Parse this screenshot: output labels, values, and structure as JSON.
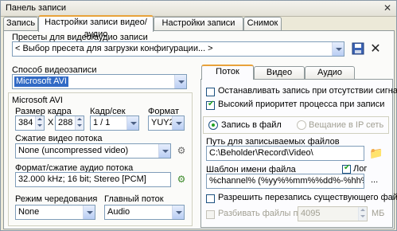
{
  "window": {
    "title": "Панель записи"
  },
  "tabs": [
    {
      "label": "Запись"
    },
    {
      "label": "Настройки записи видео/аудио"
    },
    {
      "label": "Настройки записи аудио"
    },
    {
      "label": "Снимок"
    }
  ],
  "presets": {
    "label": "Пресеты для видео/аудио записи",
    "value": "< Выбор пресета для загрузки конфигурации... >"
  },
  "capture_method": {
    "label": "Способ видеозаписи",
    "value": "Microsoft AVI"
  },
  "avi": {
    "heading": "Microsoft AVI",
    "frame_size_label": "Размер кадра",
    "width": "384",
    "x_sep": "X",
    "height": "288",
    "fps_label": "Кадр/сек",
    "fps_value": "1 / 1",
    "format_label": "Формат",
    "format_value": "YUY2",
    "video_compression_label": "Сжатие видео потока",
    "video_compression_value": "None (uncompressed video)",
    "audio_format_label": "Формат/сжатие аудио потока",
    "audio_format_value": "32.000 kHz; 16 bit; Stereo [PCM]",
    "interleave_label": "Режим чередования",
    "interleave_value": "None",
    "master_stream_label": "Главный поток",
    "master_stream_value": "Audio"
  },
  "right_tabs": [
    {
      "label": "Поток"
    },
    {
      "label": "Видео"
    },
    {
      "label": "Аудио"
    }
  ],
  "stream": {
    "stop_no_signal": {
      "label": "Останавливать запись при отсутствии сигнала",
      "checked": false
    },
    "high_priority": {
      "label": "Высокий приоритет процесса при записи",
      "checked": true
    },
    "record_to_file": {
      "label": "Запись в файл",
      "selected": true
    },
    "ip_broadcast": {
      "label": "Вещание в IP сеть",
      "selected": false
    },
    "path_label": "Путь для записываемых файлов",
    "path_value": "C:\\Beholder\\Record\\Video\\",
    "template_label": "Шаблон имени файла",
    "log": {
      "label": "Лог",
      "checked": true
    },
    "template_value": "%channel% (%yy%%mm%%dd%-%hh%%nn%",
    "more_label": "...",
    "allow_overwrite": {
      "label": "Разрешить перезапись существующего файла",
      "checked": false
    },
    "split_files": {
      "label": "Разбивать файлы по",
      "checked": false
    },
    "split_value": "4095",
    "split_unit": "МБ"
  },
  "icons": {
    "close": "close-icon",
    "save_preset": "save-icon",
    "delete_preset": "delete-icon",
    "video_codec_settings": "settings-icon",
    "audio_format_settings": "settings-icon",
    "browse_folder": "folder-icon"
  }
}
